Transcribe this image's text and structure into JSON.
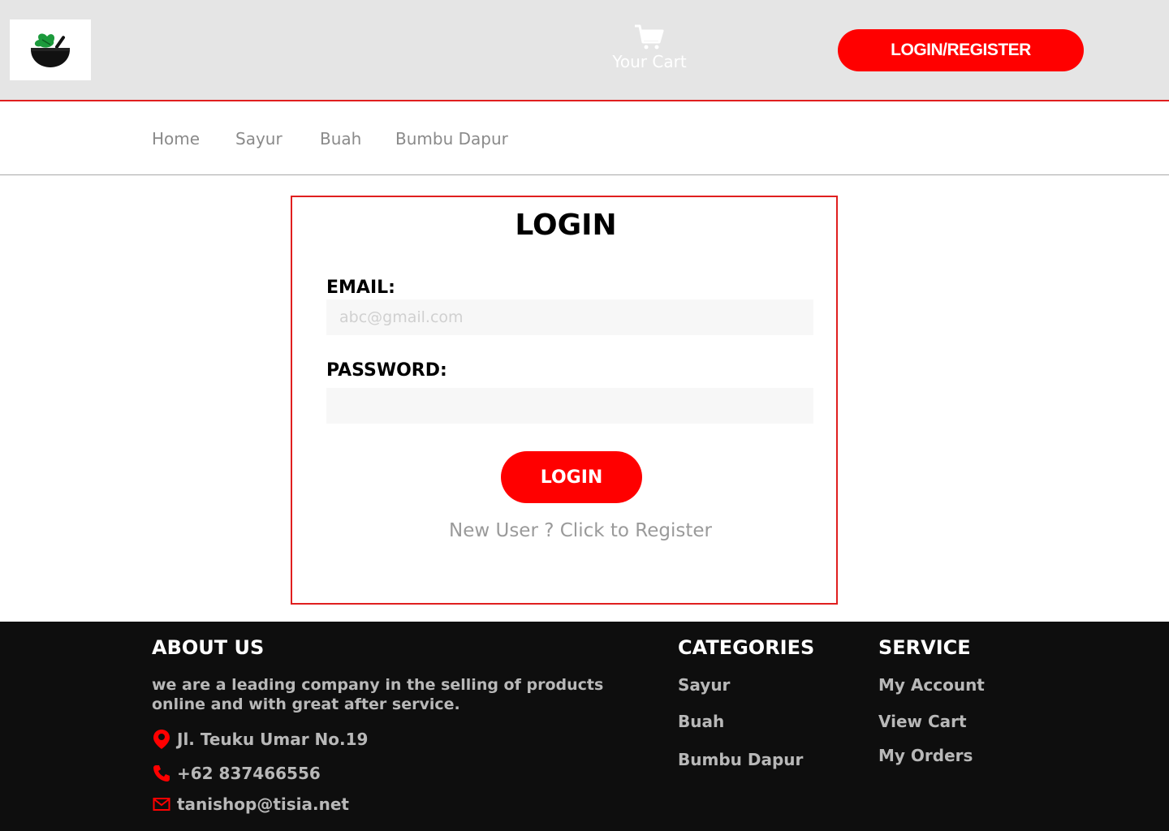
{
  "header": {
    "logo_icon": "salad-bowl-icon",
    "cart_label": "Your Cart",
    "cart_icon": "cart-icon",
    "login_register_label": "LOGIN/REGISTER",
    "accent_color": "#ff0000"
  },
  "nav": {
    "items": [
      {
        "label": "Home"
      },
      {
        "label": "Sayur"
      },
      {
        "label": "Buah"
      },
      {
        "label": "Bumbu Dapur"
      }
    ]
  },
  "login": {
    "title": "LOGIN",
    "email_label": "EMAIL:",
    "email_placeholder": "abc@gmail.com",
    "password_label": "PASSWORD:",
    "submit_label": "LOGIN",
    "register_text": "New User ? Click to Register"
  },
  "footer": {
    "about": {
      "heading": "ABOUT US",
      "text": "we are a leading company in the selling of products online and with great after service.",
      "address": "Jl. Teuku Umar No.19",
      "phone": "+62 837466556",
      "email": "tanishop@tisia.net",
      "address_icon": "location-pin-icon",
      "phone_icon": "phone-icon",
      "email_icon": "mail-icon"
    },
    "categories": {
      "heading": "CATEGORIES",
      "items": [
        {
          "label": "Sayur"
        },
        {
          "label": "Buah"
        },
        {
          "label": "Bumbu Dapur"
        }
      ]
    },
    "service": {
      "heading": "SERVICE",
      "items": [
        {
          "label": "My Account"
        },
        {
          "label": "View Cart"
        },
        {
          "label": "My Orders"
        }
      ]
    }
  }
}
